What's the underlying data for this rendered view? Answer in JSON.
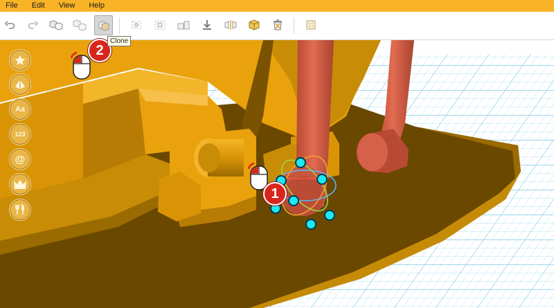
{
  "menu": {
    "items": [
      {
        "label": "File"
      },
      {
        "label": "Edit"
      },
      {
        "label": "View"
      },
      {
        "label": "Help"
      }
    ]
  },
  "toolbar": {
    "buttons": [
      {
        "name": "undo-button",
        "icon": "undo-icon"
      },
      {
        "name": "redo-button",
        "icon": "redo-icon"
      },
      {
        "name": "group-button",
        "icon": "group-icon"
      },
      {
        "name": "ungroup-button",
        "icon": "ungroup-icon"
      },
      {
        "name": "clone-button",
        "icon": "clone-icon",
        "active": true
      },
      {
        "name": "align-button",
        "icon": "align-icon"
      },
      {
        "name": "snap-button",
        "icon": "snap-icon"
      },
      {
        "name": "measure-button",
        "icon": "measure-icon"
      },
      {
        "name": "drop-to-plane-button",
        "icon": "download-icon"
      },
      {
        "name": "mirror-button",
        "icon": "mirror-icon"
      },
      {
        "name": "solid-button",
        "icon": "solid-box-icon"
      },
      {
        "name": "delete-button",
        "icon": "trash-icon"
      },
      {
        "name": "grid-button",
        "icon": "grid-icon"
      }
    ],
    "tooltip": "Clone"
  },
  "sidebar": {
    "items": [
      {
        "name": "favorites",
        "icon": "star-icon"
      },
      {
        "name": "shapes",
        "icon": "pyramid-icon"
      },
      {
        "name": "text",
        "icon": "text-icon",
        "label": "Aa"
      },
      {
        "name": "numbers",
        "icon": "numbers-icon",
        "label": "123"
      },
      {
        "name": "symbols",
        "icon": "at-icon",
        "label": "@"
      },
      {
        "name": "premium",
        "icon": "crown-icon"
      },
      {
        "name": "tools",
        "icon": "tools-icon"
      }
    ]
  },
  "annotations": [
    {
      "number": "1"
    },
    {
      "number": "2"
    }
  ],
  "colors": {
    "menubar": "#f8b326",
    "model_orange": "#e9a20c",
    "model_dark": "#6b4a00",
    "arm_red": "#cd5a42",
    "grid_lines": "#8ed0ea",
    "badge_red": "#d9261c",
    "gizmo_handle": "#1ee8f2"
  }
}
